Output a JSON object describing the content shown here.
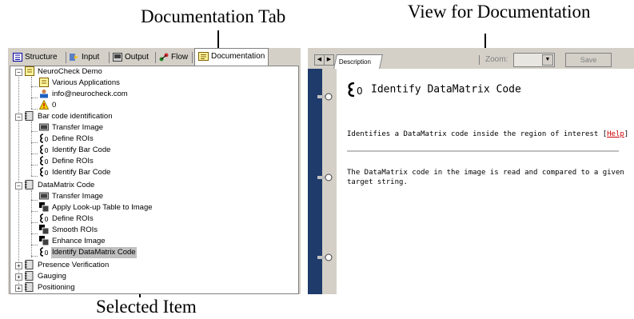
{
  "callouts": {
    "documentation_tab": "Documentation Tab",
    "view_for_documentation": "View for Documentation",
    "selected_item": "Selected Item"
  },
  "tabs": [
    {
      "label": "Structure",
      "icon": "structure-icon"
    },
    {
      "label": "Input",
      "icon": "input-icon"
    },
    {
      "label": "Output",
      "icon": "output-icon"
    },
    {
      "label": "Flow",
      "icon": "flow-icon"
    },
    {
      "label": "Documentation",
      "icon": "documentation-icon",
      "active": true
    }
  ],
  "tree": {
    "root": "NeuroCheck Demo",
    "root_children": [
      "Various Applications",
      "info@neurocheck.com",
      "0"
    ],
    "groups": [
      {
        "label": "Bar code identification",
        "items": [
          "Transfer Image",
          "Define ROIs",
          "Identify Bar Code",
          "Define ROIs",
          "Identify Bar Code"
        ]
      },
      {
        "label": "DataMatrix Code",
        "items": [
          "Transfer Image",
          "Apply Look-up Table to Image",
          "Define ROIs",
          "Smooth ROIs",
          "Enhance Image",
          "Identify DataMatrix Code"
        ]
      },
      {
        "label": "Presence Verification"
      },
      {
        "label": "Gauging"
      },
      {
        "label": "Positioning"
      }
    ],
    "selected": "Identify DataMatrix Code"
  },
  "doc": {
    "tab_label": "Description",
    "zoom_label": "Zoom:",
    "save_label": "Save",
    "title": "Identify DataMatrix Code",
    "summary_text": "Identifies a DataMatrix code inside the region of interest [",
    "help_link": "Help",
    "summary_close": "]",
    "body": "The DataMatrix code in the image is read and compared to a given target string."
  },
  "colors": {
    "panel_bg": "#d4d0c8",
    "strip_blue": "#1f3b6b",
    "link_red": "#cc0000",
    "selection": "#c0c0c0"
  }
}
